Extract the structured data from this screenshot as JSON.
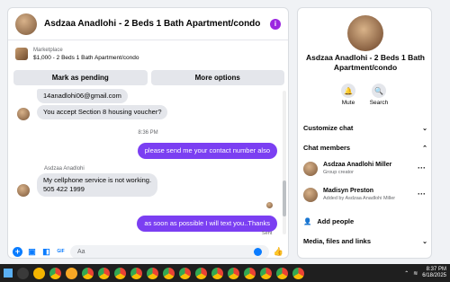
{
  "header": {
    "title": "Asdzaa Anadlohi - 2 Beds 1 Bath Apartment/condo"
  },
  "marketplace": {
    "label": "Marketplace",
    "listing": "$1,000 - 2 Beds 1 Bath Apartment/condo"
  },
  "buttons": {
    "mark_pending": "Mark as pending",
    "more_options": "More options"
  },
  "messages": {
    "email": "14anadlohi06@gmail.com",
    "section8": "You accept Section 8 housing voucher?",
    "time": "8:36 PM",
    "contact_request": "please send me your contact number also",
    "sender_name": "Asdzaa Anadlohi",
    "cell_line1": "My cellphone service is  not working.",
    "cell_line2": "505 422 1999",
    "reply": "as soon as possible I will text you..Thanks",
    "sent": "Sent"
  },
  "composer": {
    "placeholder": "Aa"
  },
  "profile": {
    "name": "Asdzaa Anadlohi - 2 Beds 1 Bath Apartment/condo",
    "mute": "Mute",
    "search": "Search"
  },
  "sections": {
    "customize": "Customize chat",
    "members": "Chat members",
    "add_people": "Add people",
    "media": "Media, files and links"
  },
  "members": [
    {
      "name": "Asdzaa Anadlohi Miller",
      "sub": "Group creator"
    },
    {
      "name": "Madisyn Preston",
      "sub": "Added by Asdzaa Anadlohi Miller"
    }
  ],
  "taskbar": {
    "time": "8:37 PM",
    "date": "6/18/2025"
  },
  "colors": {
    "accent": "#7b3ff2",
    "messenger_blue": "#0a7cff"
  }
}
